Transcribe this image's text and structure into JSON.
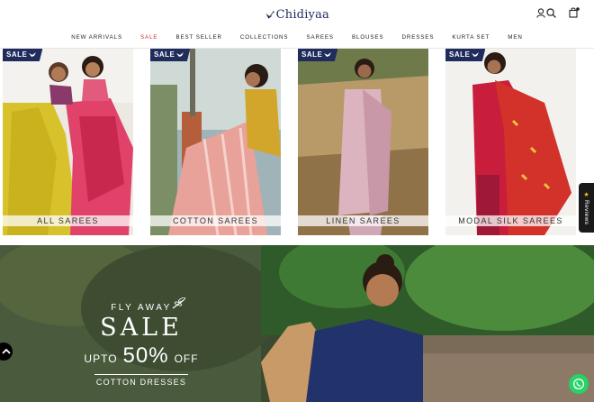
{
  "brand": {
    "name": "Chidiyaa"
  },
  "header": {
    "icons": [
      "user-icon",
      "search-icon",
      "cart-icon"
    ]
  },
  "nav": {
    "items": [
      {
        "label": "NEW ARRIVALS"
      },
      {
        "label": "SALE"
      },
      {
        "label": "BEST SELLER"
      },
      {
        "label": "COLLECTIONS"
      },
      {
        "label": "SAREES"
      },
      {
        "label": "BLOUSES"
      },
      {
        "label": "DRESSES"
      },
      {
        "label": "KURTA SET"
      },
      {
        "label": "MEN"
      }
    ],
    "sale_color": "#d62828"
  },
  "tiles": [
    {
      "tag": "SALE",
      "label": "ALL SAREES"
    },
    {
      "tag": "SALE",
      "label": "COTTON SAREES"
    },
    {
      "tag": "SALE",
      "label": "LINEN SAREES"
    },
    {
      "tag": "SALE",
      "label": "MODAL SILK SAREES"
    }
  ],
  "hero": {
    "line1": "FLY AWAY",
    "line2": "SALE",
    "upto": "UPTO",
    "percent": "50%",
    "off": "OFF",
    "category": "COTTON DRESSES"
  },
  "widgets": {
    "reviews_label": "Reviews",
    "accent_navy": "#1f2c5c",
    "whatsapp_color": "#25d366"
  }
}
